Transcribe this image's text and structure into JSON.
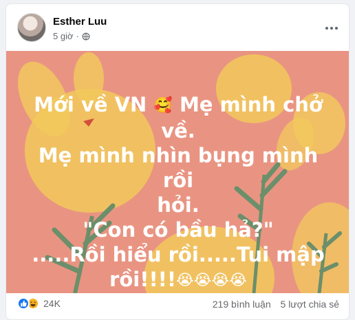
{
  "post": {
    "author": "Esther Luu",
    "time": "5 giờ",
    "separator": "·",
    "lines": [
      "Mới về VN",
      "Mẹ mình chở về.",
      "Mẹ mình nhìn bụng mình rồi",
      "hỏi.",
      "\"Con có bầu hả?\"",
      ".....Rồi hiểu rồi.....Tui mập",
      "rồi!!!!"
    ],
    "emoji_love": "🥰",
    "emoji_cry": "😭😭😭😭",
    "background_color": "#e99482",
    "accent_yellow": "#f7d46b",
    "accent_green": "#6b8f6a"
  },
  "footer": {
    "reaction_count": "24K",
    "comments": "219 bình luận",
    "shares": "5 lượt chia sẻ"
  },
  "icons": {
    "like": "like-icon",
    "haha": "haha-icon",
    "globe": "globe-icon",
    "more": "more-icon"
  }
}
